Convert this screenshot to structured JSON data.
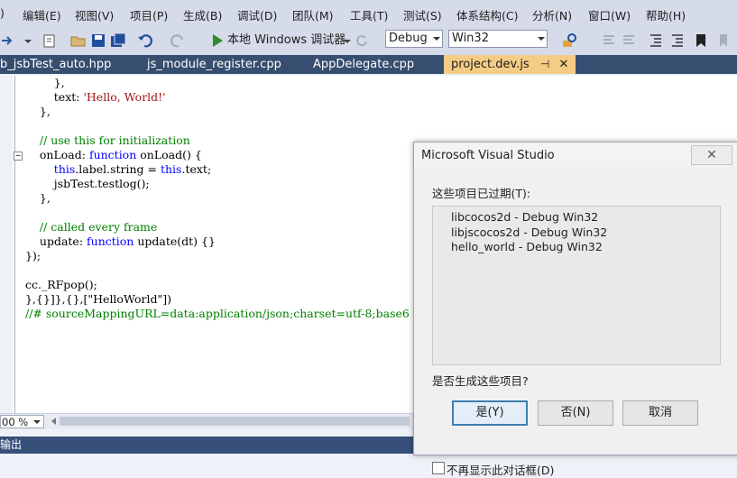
{
  "menu": [
    "编辑(E)",
    "视图(V)",
    "项目(P)",
    "生成(B)",
    "调试(D)",
    "团队(M)",
    "工具(T)",
    "测试(S)",
    "体系结构(C)",
    "分析(N)",
    "窗口(W)",
    "帮助(H)"
  ],
  "menu_partial": ")",
  "toolbar": {
    "run_label": "本地 Windows 调试器",
    "config_value": "Debug",
    "platform_value": "Win32"
  },
  "tabs": [
    "b_jsbTest_auto.hpp",
    "js_module_register.cpp",
    "AppDelegate.cpp",
    "project.dev.js"
  ],
  "active_tab_index": 3,
  "code_lines": [
    "        },",
    "        text: 'Hello, World!'",
    "    },",
    "",
    "    // use this for initialization",
    "    onLoad: function onLoad() {",
    "        this.label.string = this.text;",
    "        jsbTest.testlog();",
    "    },",
    "",
    "    // called every frame",
    "    update: function update(dt) {}",
    "});",
    "",
    "cc._RFpop();",
    "},{}]},{},[\"HelloWorld\"])",
    "//# sourceMappingURL=data:application/json;charset=utf-8;base6"
  ],
  "zoom": "00 %",
  "status": "输出",
  "dialog": {
    "title": "Microsoft Visual Studio",
    "close": "✕",
    "list_label": "这些项目已过期(T):",
    "items": [
      "libcocos2d - Debug Win32",
      "libjscocos2d - Debug Win32",
      "hello_world - Debug Win32"
    ],
    "question": "是否生成这些项目?",
    "yes": "是(Y)",
    "no": "否(N)",
    "cancel": "取消",
    "dont_show": "不再显示此对话框(D)"
  },
  "colors": {
    "menubar": "#d6dbe9",
    "tabstrip": "#364e6f",
    "active_tab": "#f5cc84",
    "keyword": "#0000ff",
    "string": "#a31515",
    "comment": "#008000",
    "statusbar": "#37507a"
  }
}
